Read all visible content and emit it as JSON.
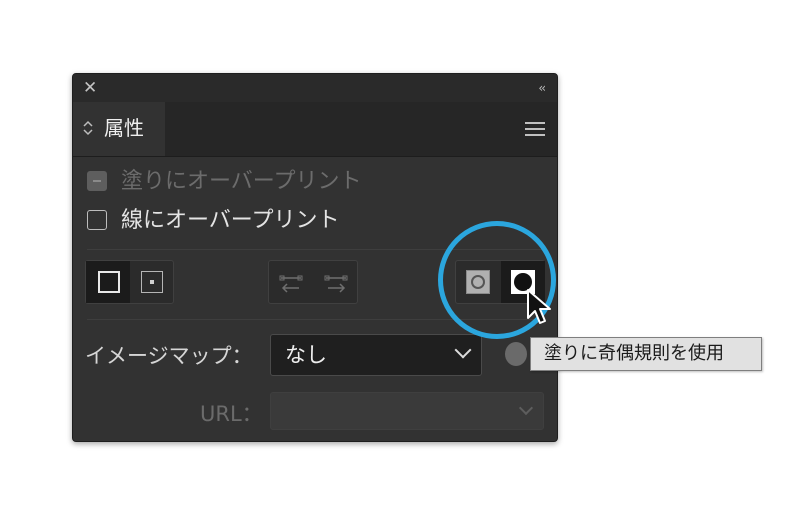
{
  "panel": {
    "close_glyph": "✕",
    "collapse_glyph": "‹‹",
    "tab": {
      "arrows": "⌃⌄",
      "label": "属性"
    }
  },
  "overprint": {
    "fill_label": "塗りにオーバープリント",
    "stroke_label": "線にオーバープリント"
  },
  "imagemap": {
    "label": "イメージマップ：",
    "value": "なし"
  },
  "url": {
    "label": "URL：",
    "value": ""
  },
  "tooltip": {
    "text": "塗りに奇偶規則を使用"
  },
  "colors": {
    "highlight_ring": "#2ba6de",
    "panel_bg": "#323232"
  }
}
